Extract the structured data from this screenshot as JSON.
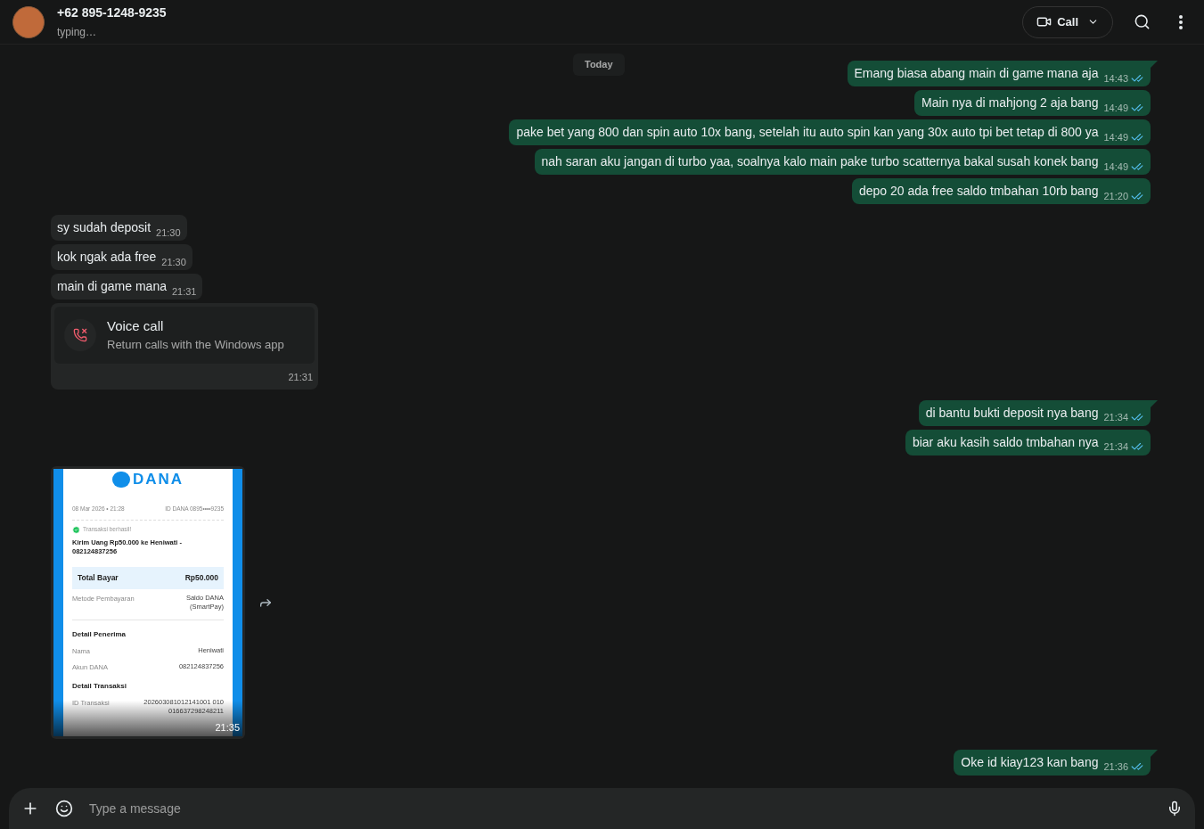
{
  "contact": {
    "name": "+62 895-1248-9235",
    "status": "typing…"
  },
  "call_button": {
    "label": "Call"
  },
  "date_label": "Today",
  "messages": [
    {
      "kind": "outgoing",
      "text": "Emang biasa abang main di game mana aja",
      "time": "14:43",
      "read": true,
      "tail": true
    },
    {
      "kind": "outgoing",
      "text": "Main nya di mahjong 2 aja bang",
      "time": "14:49",
      "read": true,
      "tail": false
    },
    {
      "kind": "outgoing",
      "text": "pake bet yang 800 dan spin auto 10x bang, setelah itu auto spin kan yang 30x auto tpi bet tetap di 800 ya",
      "time": "14:49",
      "read": true,
      "tail": false
    },
    {
      "kind": "outgoing",
      "text": "nah saran aku jangan di turbo yaa, soalnya kalo main pake turbo scatternya bakal susah konek bang",
      "time": "14:49",
      "read": true,
      "tail": false
    },
    {
      "kind": "outgoing",
      "text": "depo 20 ada free saldo tmbahan 10rb bang",
      "time": "21:20",
      "read": true,
      "tail": false
    },
    {
      "kind": "incoming",
      "text": "sy sudah deposit",
      "time": "21:30"
    },
    {
      "kind": "incoming",
      "text": "kok ngak ada free",
      "time": "21:30"
    },
    {
      "kind": "incoming",
      "text": "main di game mana",
      "time": "21:31"
    },
    {
      "kind": "call",
      "title": "Voice call",
      "subtitle": "Return calls with the Windows app",
      "time": "21:31"
    },
    {
      "kind": "outgoing",
      "text": "di bantu bukti deposit nya bang",
      "time": "21:34",
      "read": true,
      "tail": true
    },
    {
      "kind": "outgoing",
      "text": "biar aku kasih saldo tmbahan nya",
      "time": "21:34",
      "read": true,
      "tail": false
    },
    {
      "kind": "image",
      "time": "21:35",
      "receipt": {
        "logo": "DANA",
        "date": "08 Mar 2026 • 21:28",
        "account": "ID DANA 0895••••9235",
        "status": "Transaksi berhasil!",
        "description": "Kirim Uang Rp50.000 ke Heniwati - 082124837256",
        "total_label": "Total Bayar",
        "total_value": "Rp50.000",
        "payment_label": "Metode Pembayaran",
        "payment_value": "Saldo DANA (SmartPay)",
        "sections": [
          {
            "title": "Detail Penerima",
            "rows": [
              {
                "label": "Nama",
                "value": "Heniwati"
              },
              {
                "label": "Akun DANA",
                "value": "082124837256"
              }
            ]
          },
          {
            "title": "Detail Transaksi",
            "rows": [
              {
                "label": "ID Transaksi",
                "value": "202603081012141001 010016637298248211"
              }
            ]
          }
        ]
      }
    },
    {
      "kind": "outgoing",
      "text": "Oke id kiay123  kan bang",
      "time": "21:36",
      "read": true,
      "tail": true
    }
  ],
  "composer": {
    "placeholder": "Type a message"
  }
}
